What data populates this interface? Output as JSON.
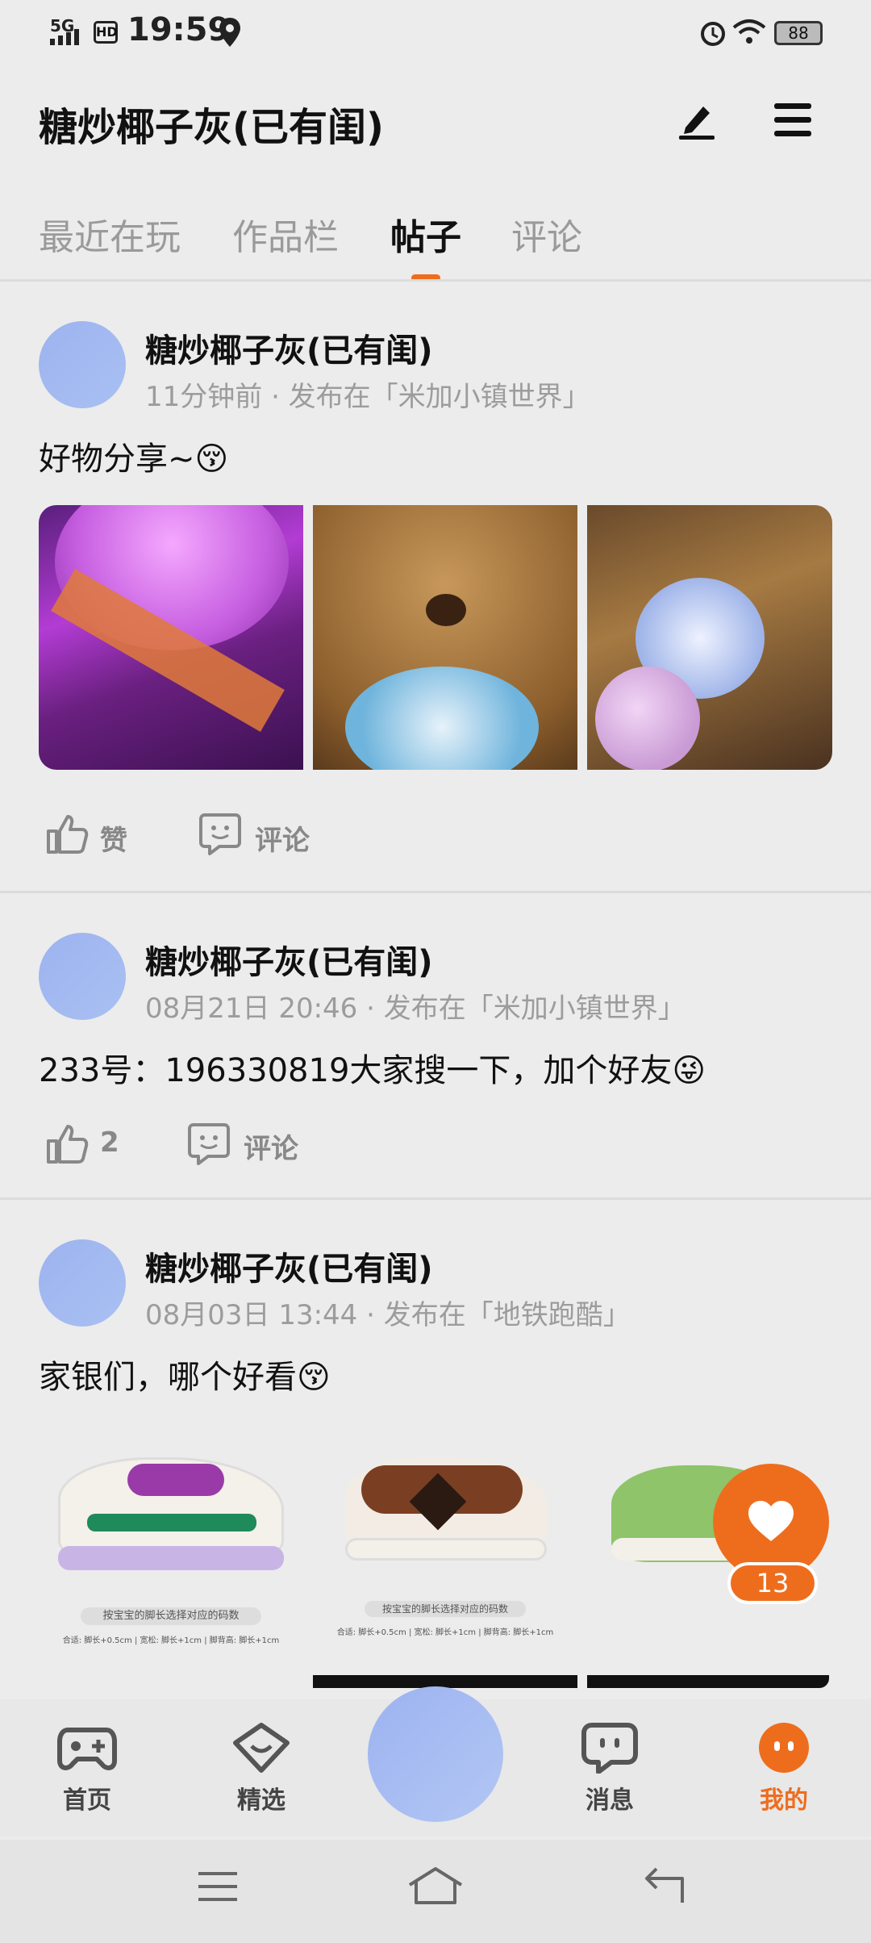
{
  "status_bar": {
    "signal": "5G",
    "hd": "HD",
    "time": "19:59",
    "battery": "88"
  },
  "header": {
    "title": "糖炒椰子灰(已有闺)",
    "edit_icon": "pen-icon",
    "menu_icon": "menu-icon"
  },
  "tabs": [
    {
      "label": "最近在玩"
    },
    {
      "label": "作品栏"
    },
    {
      "label": "帖子"
    },
    {
      "label": "评论"
    }
  ],
  "active_tab": "帖子",
  "posts": [
    {
      "author": "糖炒椰子灰(已有闺)",
      "meta": "11分钟前 · 发布在「米加小镇世界」",
      "text": "好物分享~😚",
      "like_label": "赞",
      "comment_label": "评论"
    },
    {
      "author": "糖炒椰子灰(已有闺)",
      "meta": "08月21日 20:46 · 发布在「米加小镇世界」",
      "text": "233号：196330819大家搜一下，加个好友😜",
      "like_label": "2",
      "comment_label": "评论"
    },
    {
      "author": "糖炒椰子灰(已有闺)",
      "meta": "08月03日 13:44 · 发布在「地铁跑酷」",
      "text": "家银们，哪个好看😚",
      "shoe_caption": "按宝宝的脚长选择对应的码数",
      "shoe_sub": "合适: 脚长+0.5cm | 宽松: 脚长+1cm | 脚背高: 脚长+1cm"
    }
  ],
  "fab": {
    "count": "13"
  },
  "bottom_nav": [
    {
      "label": "首页"
    },
    {
      "label": "精选"
    },
    {
      "label": "消息"
    },
    {
      "label": "我的"
    }
  ],
  "colors": {
    "accent": "#ee6d1d",
    "avatar": "#a4b9f1"
  }
}
